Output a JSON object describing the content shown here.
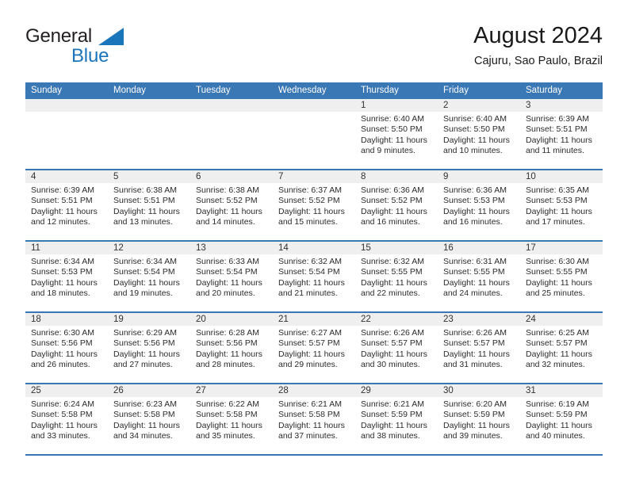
{
  "brand": {
    "name_part1": "General",
    "name_part2": "Blue"
  },
  "header": {
    "title": "August 2024",
    "subtitle": "Cajuru, Sao Paulo, Brazil"
  },
  "calendar": {
    "weekday_headers": [
      "Sunday",
      "Monday",
      "Tuesday",
      "Wednesday",
      "Thursday",
      "Friday",
      "Saturday"
    ],
    "accent_color": "#3a77b5",
    "daynum_band_color": "#efefef",
    "weeks": [
      [
        {
          "day": "",
          "sunrise": "",
          "sunset": "",
          "daylight_1": "",
          "daylight_2": ""
        },
        {
          "day": "",
          "sunrise": "",
          "sunset": "",
          "daylight_1": "",
          "daylight_2": ""
        },
        {
          "day": "",
          "sunrise": "",
          "sunset": "",
          "daylight_1": "",
          "daylight_2": ""
        },
        {
          "day": "",
          "sunrise": "",
          "sunset": "",
          "daylight_1": "",
          "daylight_2": ""
        },
        {
          "day": "1",
          "sunrise": "Sunrise: 6:40 AM",
          "sunset": "Sunset: 5:50 PM",
          "daylight_1": "Daylight: 11 hours",
          "daylight_2": "and 9 minutes."
        },
        {
          "day": "2",
          "sunrise": "Sunrise: 6:40 AM",
          "sunset": "Sunset: 5:50 PM",
          "daylight_1": "Daylight: 11 hours",
          "daylight_2": "and 10 minutes."
        },
        {
          "day": "3",
          "sunrise": "Sunrise: 6:39 AM",
          "sunset": "Sunset: 5:51 PM",
          "daylight_1": "Daylight: 11 hours",
          "daylight_2": "and 11 minutes."
        }
      ],
      [
        {
          "day": "4",
          "sunrise": "Sunrise: 6:39 AM",
          "sunset": "Sunset: 5:51 PM",
          "daylight_1": "Daylight: 11 hours",
          "daylight_2": "and 12 minutes."
        },
        {
          "day": "5",
          "sunrise": "Sunrise: 6:38 AM",
          "sunset": "Sunset: 5:51 PM",
          "daylight_1": "Daylight: 11 hours",
          "daylight_2": "and 13 minutes."
        },
        {
          "day": "6",
          "sunrise": "Sunrise: 6:38 AM",
          "sunset": "Sunset: 5:52 PM",
          "daylight_1": "Daylight: 11 hours",
          "daylight_2": "and 14 minutes."
        },
        {
          "day": "7",
          "sunrise": "Sunrise: 6:37 AM",
          "sunset": "Sunset: 5:52 PM",
          "daylight_1": "Daylight: 11 hours",
          "daylight_2": "and 15 minutes."
        },
        {
          "day": "8",
          "sunrise": "Sunrise: 6:36 AM",
          "sunset": "Sunset: 5:52 PM",
          "daylight_1": "Daylight: 11 hours",
          "daylight_2": "and 16 minutes."
        },
        {
          "day": "9",
          "sunrise": "Sunrise: 6:36 AM",
          "sunset": "Sunset: 5:53 PM",
          "daylight_1": "Daylight: 11 hours",
          "daylight_2": "and 16 minutes."
        },
        {
          "day": "10",
          "sunrise": "Sunrise: 6:35 AM",
          "sunset": "Sunset: 5:53 PM",
          "daylight_1": "Daylight: 11 hours",
          "daylight_2": "and 17 minutes."
        }
      ],
      [
        {
          "day": "11",
          "sunrise": "Sunrise: 6:34 AM",
          "sunset": "Sunset: 5:53 PM",
          "daylight_1": "Daylight: 11 hours",
          "daylight_2": "and 18 minutes."
        },
        {
          "day": "12",
          "sunrise": "Sunrise: 6:34 AM",
          "sunset": "Sunset: 5:54 PM",
          "daylight_1": "Daylight: 11 hours",
          "daylight_2": "and 19 minutes."
        },
        {
          "day": "13",
          "sunrise": "Sunrise: 6:33 AM",
          "sunset": "Sunset: 5:54 PM",
          "daylight_1": "Daylight: 11 hours",
          "daylight_2": "and 20 minutes."
        },
        {
          "day": "14",
          "sunrise": "Sunrise: 6:32 AM",
          "sunset": "Sunset: 5:54 PM",
          "daylight_1": "Daylight: 11 hours",
          "daylight_2": "and 21 minutes."
        },
        {
          "day": "15",
          "sunrise": "Sunrise: 6:32 AM",
          "sunset": "Sunset: 5:55 PM",
          "daylight_1": "Daylight: 11 hours",
          "daylight_2": "and 22 minutes."
        },
        {
          "day": "16",
          "sunrise": "Sunrise: 6:31 AM",
          "sunset": "Sunset: 5:55 PM",
          "daylight_1": "Daylight: 11 hours",
          "daylight_2": "and 24 minutes."
        },
        {
          "day": "17",
          "sunrise": "Sunrise: 6:30 AM",
          "sunset": "Sunset: 5:55 PM",
          "daylight_1": "Daylight: 11 hours",
          "daylight_2": "and 25 minutes."
        }
      ],
      [
        {
          "day": "18",
          "sunrise": "Sunrise: 6:30 AM",
          "sunset": "Sunset: 5:56 PM",
          "daylight_1": "Daylight: 11 hours",
          "daylight_2": "and 26 minutes."
        },
        {
          "day": "19",
          "sunrise": "Sunrise: 6:29 AM",
          "sunset": "Sunset: 5:56 PM",
          "daylight_1": "Daylight: 11 hours",
          "daylight_2": "and 27 minutes."
        },
        {
          "day": "20",
          "sunrise": "Sunrise: 6:28 AM",
          "sunset": "Sunset: 5:56 PM",
          "daylight_1": "Daylight: 11 hours",
          "daylight_2": "and 28 minutes."
        },
        {
          "day": "21",
          "sunrise": "Sunrise: 6:27 AM",
          "sunset": "Sunset: 5:57 PM",
          "daylight_1": "Daylight: 11 hours",
          "daylight_2": "and 29 minutes."
        },
        {
          "day": "22",
          "sunrise": "Sunrise: 6:26 AM",
          "sunset": "Sunset: 5:57 PM",
          "daylight_1": "Daylight: 11 hours",
          "daylight_2": "and 30 minutes."
        },
        {
          "day": "23",
          "sunrise": "Sunrise: 6:26 AM",
          "sunset": "Sunset: 5:57 PM",
          "daylight_1": "Daylight: 11 hours",
          "daylight_2": "and 31 minutes."
        },
        {
          "day": "24",
          "sunrise": "Sunrise: 6:25 AM",
          "sunset": "Sunset: 5:57 PM",
          "daylight_1": "Daylight: 11 hours",
          "daylight_2": "and 32 minutes."
        }
      ],
      [
        {
          "day": "25",
          "sunrise": "Sunrise: 6:24 AM",
          "sunset": "Sunset: 5:58 PM",
          "daylight_1": "Daylight: 11 hours",
          "daylight_2": "and 33 minutes."
        },
        {
          "day": "26",
          "sunrise": "Sunrise: 6:23 AM",
          "sunset": "Sunset: 5:58 PM",
          "daylight_1": "Daylight: 11 hours",
          "daylight_2": "and 34 minutes."
        },
        {
          "day": "27",
          "sunrise": "Sunrise: 6:22 AM",
          "sunset": "Sunset: 5:58 PM",
          "daylight_1": "Daylight: 11 hours",
          "daylight_2": "and 35 minutes."
        },
        {
          "day": "28",
          "sunrise": "Sunrise: 6:21 AM",
          "sunset": "Sunset: 5:58 PM",
          "daylight_1": "Daylight: 11 hours",
          "daylight_2": "and 37 minutes."
        },
        {
          "day": "29",
          "sunrise": "Sunrise: 6:21 AM",
          "sunset": "Sunset: 5:59 PM",
          "daylight_1": "Daylight: 11 hours",
          "daylight_2": "and 38 minutes."
        },
        {
          "day": "30",
          "sunrise": "Sunrise: 6:20 AM",
          "sunset": "Sunset: 5:59 PM",
          "daylight_1": "Daylight: 11 hours",
          "daylight_2": "and 39 minutes."
        },
        {
          "day": "31",
          "sunrise": "Sunrise: 6:19 AM",
          "sunset": "Sunset: 5:59 PM",
          "daylight_1": "Daylight: 11 hours",
          "daylight_2": "and 40 minutes."
        }
      ]
    ]
  }
}
